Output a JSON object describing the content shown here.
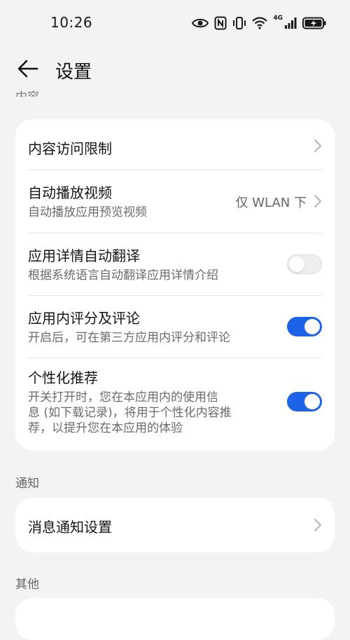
{
  "status_bar": {
    "time": "10:26",
    "network_label": "4G",
    "icons": [
      "eye-icon",
      "nfc-icon",
      "vibrate-icon",
      "wifi-icon",
      "signal-icon",
      "battery-charging-icon"
    ]
  },
  "header": {
    "title": "设置",
    "back_icon": "arrow-left-icon"
  },
  "clipped_section_heading": "内容",
  "content_card": {
    "rows": [
      {
        "label": "内容访问限制",
        "subtitle": "",
        "control": "chevron"
      },
      {
        "label": "自动播放视频",
        "subtitle": "自动播放应用预览视频",
        "value": "仅 WLAN 下",
        "control": "chevron"
      },
      {
        "label": "应用详情自动翻译",
        "subtitle": "根据系统语言自动翻译应用详情介绍",
        "control": "toggle",
        "enabled": false
      },
      {
        "label": "应用内评分及评论",
        "subtitle": "开启后，可在第三方应用内评分和评论",
        "control": "toggle",
        "enabled": true
      },
      {
        "label": "个性化推荐",
        "subtitle_lines": [
          "开关打开时，您在本应用内的使用信",
          "息 (如下载记录)，将用于个性化内容推",
          "荐，以提升您在本应用的体验"
        ],
        "control": "toggle",
        "enabled": true
      }
    ]
  },
  "notification_section": {
    "heading": "通知",
    "rows": [
      {
        "label": "消息通知设置",
        "control": "chevron"
      }
    ]
  },
  "other_section": {
    "heading": "其他"
  },
  "colors": {
    "background": "#f1f3f5",
    "card": "#ffffff",
    "accent": "#1d63e8",
    "toggle_off": "#eeeeee"
  }
}
